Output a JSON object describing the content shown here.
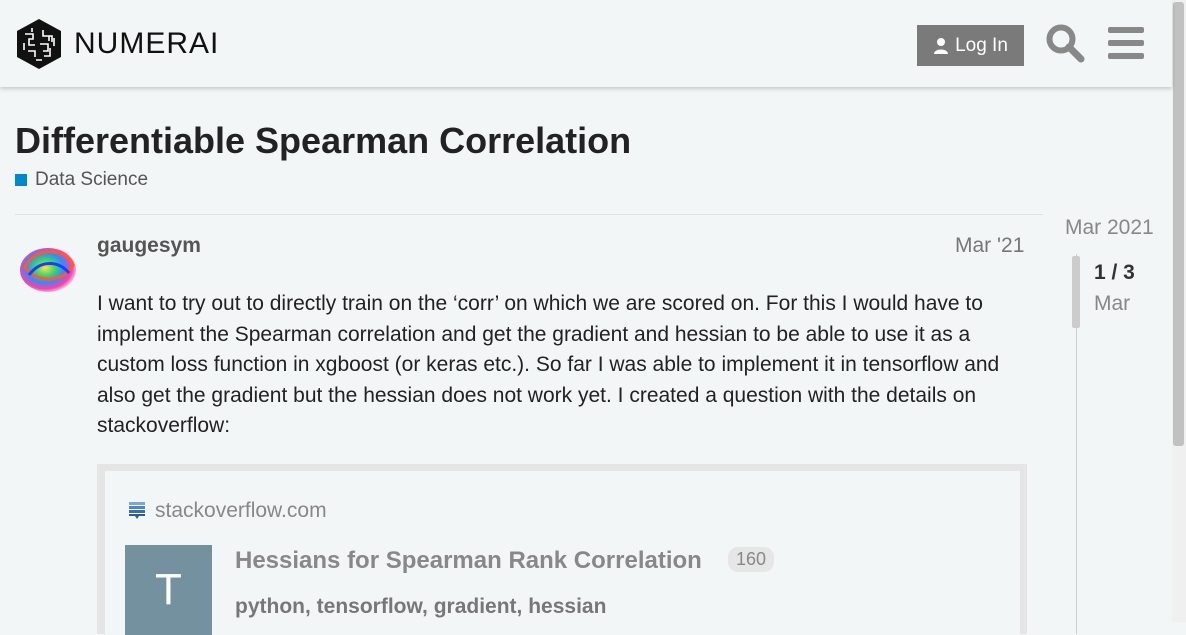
{
  "header": {
    "brand": "NUMERAI",
    "login_label": "Log In"
  },
  "topic": {
    "title": "Differentiable Spearman Correlation",
    "category": "Data Science",
    "category_color": "#0088cc"
  },
  "post": {
    "username": "gaugesym",
    "date": "Mar '21",
    "body": "I want to try out to directly train on the ‘corr’ on which we are scored on. For this I would have to implement the Spearman correlation and get the gradient and hessian to be able to use it as a custom loss function in xgboost (or keras etc.). So far I was able to implement it in tensorflow and also get the gradient but the hessian does not work yet. I created a question with the details on stackoverflow:",
    "onebox": {
      "domain": "stackoverflow.com",
      "thumb_letter": "T",
      "question_title": "Hessians for Spearman Rank Correlation",
      "count": "160",
      "tags": "python, tensorflow, gradient, hessian"
    }
  },
  "timeline": {
    "start_date": "Mar 2021",
    "progress": "1 / 3",
    "current_date": "Mar"
  }
}
